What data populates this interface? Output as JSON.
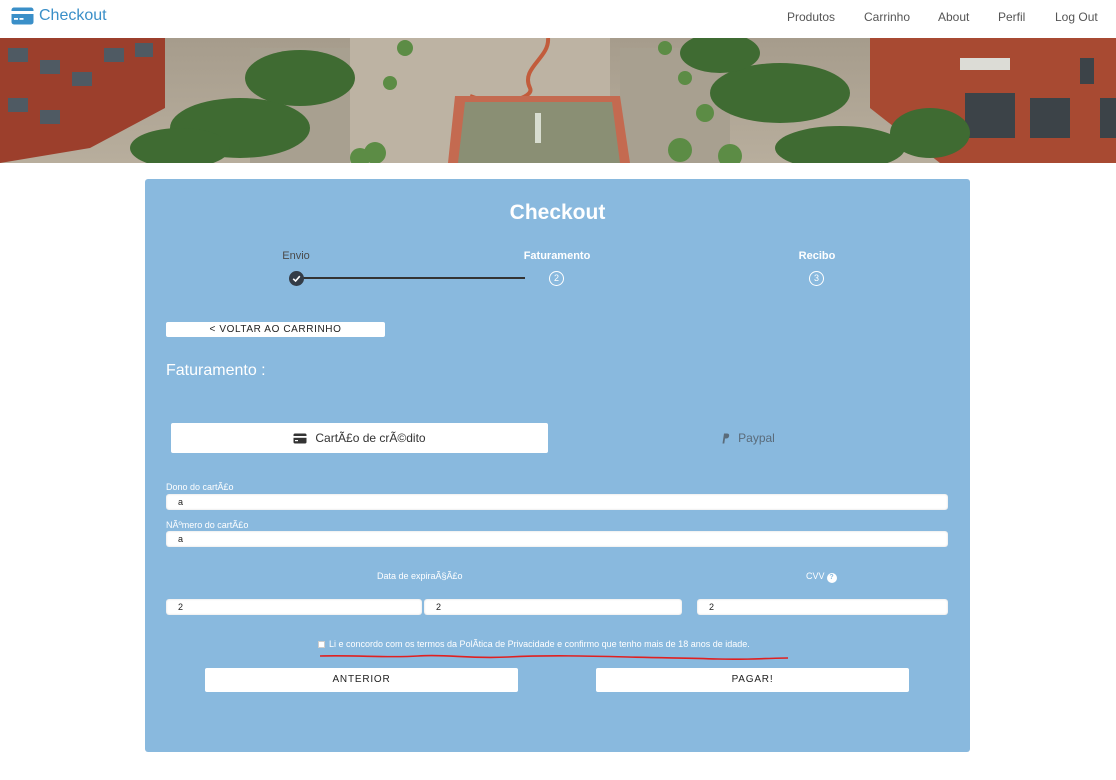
{
  "navbar": {
    "brand": "Checkout",
    "links": [
      "Produtos",
      "Carrinho",
      "About",
      "Perfil",
      "Log Out"
    ]
  },
  "checkout": {
    "title": "Checkout",
    "steps": [
      {
        "label": "Envio",
        "status": "done"
      },
      {
        "label": "Faturamento",
        "number": "2",
        "status": "current"
      },
      {
        "label": "Recibo",
        "number": "3",
        "status": "pending"
      }
    ],
    "back_label": "< VOLTAR AO CARRINHO",
    "section_title": "Faturamento :",
    "tabs": {
      "credit_card": "CartÃ£o de crÃ©dito",
      "paypal": "Paypal"
    },
    "fields": {
      "card_owner_label": "Dono do cartÃ£o",
      "card_owner_value": "a",
      "card_number_label": "NÃºmero do cartÃ£o",
      "card_number_value": "a",
      "expiry_label": "Data de expiraÃ§Ã£o",
      "expiry_month_value": "2",
      "expiry_year_value": "2",
      "cvv_label": "CVV",
      "cvv_help": "?",
      "cvv_value": "2"
    },
    "terms_text": "Li e concordo com os termos da PolÃ­tica de Privacidade e confirmo que tenho mais de 18 anos de idade.",
    "prev_label": "ANTERIOR",
    "pay_label": "PAGAR!"
  },
  "colors": {
    "brand": "#3a8fc8",
    "card_bg": "#89b9de",
    "annotation": "#e02020"
  },
  "icons": {
    "brand": "credit-card-icon",
    "step_done": "check-icon",
    "card_tab": "credit-card-icon",
    "paypal_tab": "paypal-icon",
    "cvv_help": "help-icon"
  }
}
